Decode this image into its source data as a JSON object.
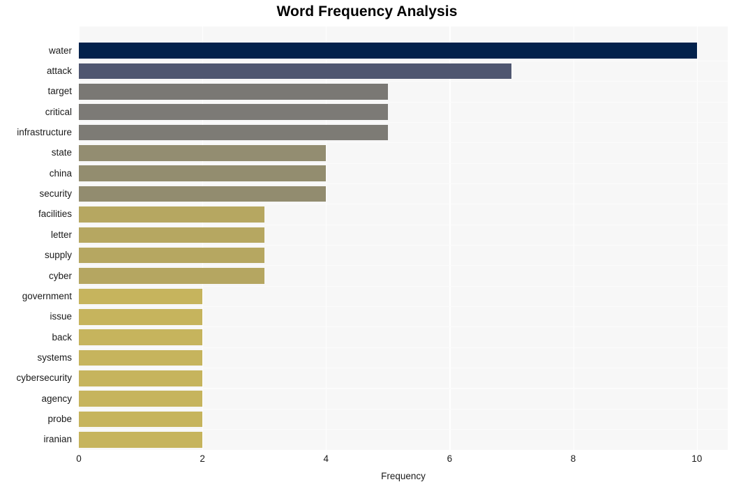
{
  "chart_data": {
    "type": "bar",
    "orientation": "horizontal",
    "title": "Word Frequency Analysis",
    "xlabel": "Frequency",
    "ylabel": "",
    "categories": [
      "water",
      "attack",
      "target",
      "critical",
      "infrastructure",
      "state",
      "china",
      "security",
      "facilities",
      "letter",
      "supply",
      "cyber",
      "government",
      "issue",
      "back",
      "systems",
      "cybersecurity",
      "agency",
      "probe",
      "iranian"
    ],
    "values": [
      10,
      7,
      5,
      5,
      5,
      4,
      4,
      4,
      3,
      3,
      3,
      3,
      2,
      2,
      2,
      2,
      2,
      2,
      2,
      2
    ],
    "bar_colors": [
      "#03224c",
      "#4f5670",
      "#7a7874",
      "#7c7a76",
      "#7d7b75",
      "#938d71",
      "#938d6f",
      "#928c6f",
      "#b6a761",
      "#b6a761",
      "#b6a761",
      "#b5a661",
      "#c6b45d",
      "#c6b45d",
      "#c6b45d",
      "#c6b45d",
      "#c6b45d",
      "#c6b45d",
      "#c6b45d",
      "#c6b45d"
    ],
    "xlim": [
      0,
      10.5
    ],
    "xticks": [
      0,
      2,
      4,
      6,
      8,
      10
    ],
    "xtick_labels": [
      "0",
      "2",
      "4",
      "6",
      "8",
      "10"
    ],
    "grid": "vertical-white",
    "legend": "none",
    "plot_background": "#f7f7f7",
    "figure_background": "#ffffff",
    "title_color": "#000000",
    "tick_label_color": "#1a1a1a"
  }
}
